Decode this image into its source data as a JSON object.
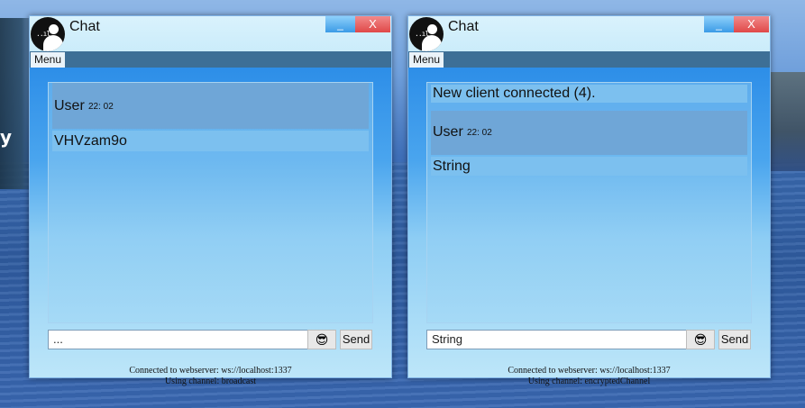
{
  "windows": {
    "left": {
      "title": "Chat",
      "minimize_label": "_",
      "close_label": "X",
      "menu_label": "Menu",
      "messages": [
        {
          "user": "User",
          "time": "22: 02",
          "text": "VHVzam9o"
        }
      ],
      "input_value": "...",
      "emoji": "😎",
      "send_label": "Send",
      "status_server": "Connected to webserver: ws://localhost:1337",
      "status_channel": "Using channel: broadcast"
    },
    "right": {
      "title": "Chat",
      "minimize_label": "_",
      "close_label": "X",
      "menu_label": "Menu",
      "system_message": "New client connected (4).",
      "messages": [
        {
          "user": "User",
          "time": "22: 02",
          "text": "String"
        }
      ],
      "input_value": "String",
      "emoji": "😎",
      "send_label": "Send",
      "status_server": "Connected to webserver: ws://localhost:1337",
      "status_channel": "Using channel: encryptedChannel"
    }
  },
  "background": {
    "partial_text": "y"
  }
}
